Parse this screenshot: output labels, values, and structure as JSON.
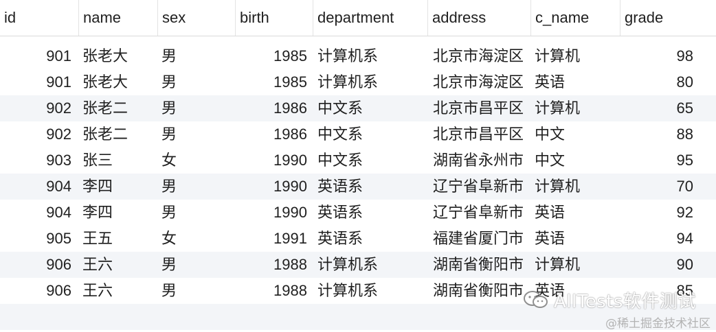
{
  "table": {
    "columns": [
      "id",
      "name",
      "sex",
      "birth",
      "department",
      "address",
      "c_name",
      "grade"
    ],
    "rows": [
      {
        "id": "901",
        "name": "张老大",
        "sex": "男",
        "birth": "1985",
        "department": "计算机系",
        "address": "北京市海淀区",
        "c_name": "计算机",
        "grade": "98"
      },
      {
        "id": "901",
        "name": "张老大",
        "sex": "男",
        "birth": "1985",
        "department": "计算机系",
        "address": "北京市海淀区",
        "c_name": "英语",
        "grade": "80"
      },
      {
        "id": "902",
        "name": "张老二",
        "sex": "男",
        "birth": "1986",
        "department": "中文系",
        "address": "北京市昌平区",
        "c_name": "计算机",
        "grade": "65"
      },
      {
        "id": "902",
        "name": "张老二",
        "sex": "男",
        "birth": "1986",
        "department": "中文系",
        "address": "北京市昌平区",
        "c_name": "中文",
        "grade": "88"
      },
      {
        "id": "903",
        "name": "张三",
        "sex": "女",
        "birth": "1990",
        "department": "中文系",
        "address": "湖南省永州市",
        "c_name": "中文",
        "grade": "95"
      },
      {
        "id": "904",
        "name": "李四",
        "sex": "男",
        "birth": "1990",
        "department": "英语系",
        "address": "辽宁省阜新市",
        "c_name": "计算机",
        "grade": "70"
      },
      {
        "id": "904",
        "name": "李四",
        "sex": "男",
        "birth": "1990",
        "department": "英语系",
        "address": "辽宁省阜新市",
        "c_name": "英语",
        "grade": "92"
      },
      {
        "id": "905",
        "name": "王五",
        "sex": "女",
        "birth": "1991",
        "department": "英语系",
        "address": "福建省厦门市",
        "c_name": "英语",
        "grade": "94"
      },
      {
        "id": "906",
        "name": "王六",
        "sex": "男",
        "birth": "1988",
        "department": "计算机系",
        "address": "湖南省衡阳市",
        "c_name": "计算机",
        "grade": "90"
      },
      {
        "id": "906",
        "name": "王六",
        "sex": "男",
        "birth": "1988",
        "department": "计算机系",
        "address": "湖南省衡阳市",
        "c_name": "英语",
        "grade": "85"
      }
    ]
  },
  "watermark": {
    "text": "AllTests软件测试",
    "icon": "wechat-icon"
  },
  "source_label": "@稀土掘金技术社区",
  "colors": {
    "row_alt_bg": "#f3f5f8",
    "header_border": "#d9d9d9",
    "text": "#1f1f1f"
  }
}
